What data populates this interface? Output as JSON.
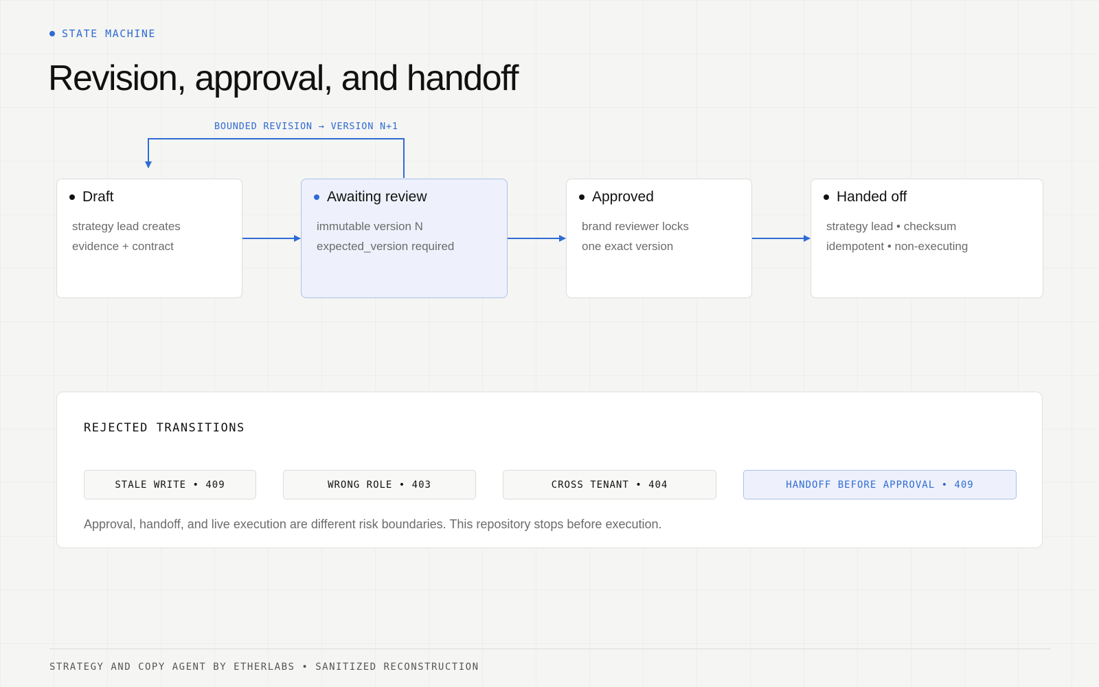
{
  "header": {
    "eyebrow": "STATE MACHINE",
    "title": "Revision, approval, and handoff"
  },
  "diagram": {
    "loop_label": "BOUNDED REVISION → VERSION N+1",
    "states": [
      {
        "name": "Draft",
        "lines": [
          "strategy lead creates",
          "evidence + contract"
        ],
        "highlighted": false
      },
      {
        "name": "Awaiting review",
        "lines": [
          "immutable version N",
          "expected_version required"
        ],
        "highlighted": true
      },
      {
        "name": "Approved",
        "lines": [
          "brand reviewer locks",
          "one exact version"
        ],
        "highlighted": false
      },
      {
        "name": "Handed off",
        "lines": [
          "strategy lead • checksum",
          "idempotent • non-executing"
        ],
        "highlighted": false
      }
    ]
  },
  "rejected": {
    "title": "REJECTED TRANSITIONS",
    "chips": [
      "STALE WRITE • 409",
      "WRONG ROLE • 403",
      "CROSS TENANT • 404",
      "HANDOFF BEFORE APPROVAL • 409"
    ],
    "note": "Approval, handoff, and live execution are different risk boundaries. This repository stops before execution."
  },
  "footer": "STRATEGY AND COPY AGENT BY ETHERLABS • SANITIZED RECONSTRUCTION",
  "colors": {
    "accent": "#2f6bd3",
    "highlight_fill": "#eef1fb",
    "background": "#f5f5f3"
  }
}
